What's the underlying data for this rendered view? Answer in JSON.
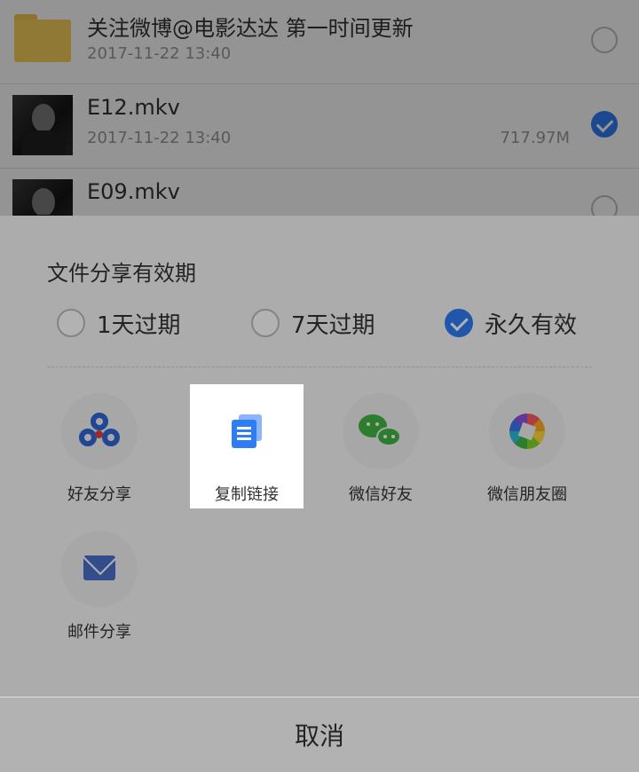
{
  "file_list": {
    "items": [
      {
        "name": "关注微博@电影达达 第一时间更新",
        "date": "2017-11-22 13:40",
        "size": "",
        "type_icon": "folder-icon",
        "selected": false
      },
      {
        "name": "E12.mkv",
        "date": "2017-11-22 13:40",
        "size": "717.97M",
        "type_icon": "video-thumbnail",
        "selected": true
      },
      {
        "name": "E09.mkv",
        "date": "",
        "size": "",
        "type_icon": "video-thumbnail",
        "selected": false
      }
    ]
  },
  "share_sheet": {
    "title": "文件分享有效期",
    "validity_options": [
      {
        "label": "1天过期",
        "selected": false
      },
      {
        "label": "7天过期",
        "selected": false
      },
      {
        "label": "永久有效",
        "selected": true
      }
    ],
    "share_targets": [
      {
        "label": "好友分享",
        "icon": "baidu-cloud-icon"
      },
      {
        "label": "复制链接",
        "icon": "copy-link-icon",
        "highlighted": true
      },
      {
        "label": "微信好友",
        "icon": "wechat-icon"
      },
      {
        "label": "微信朋友圈",
        "icon": "wechat-moments-icon"
      },
      {
        "label": "邮件分享",
        "icon": "mail-icon"
      }
    ],
    "cancel_label": "取消"
  },
  "colors": {
    "accent": "#2f7df6",
    "wechat_green": "#3fb442",
    "folder_yellow": "#f6d15c"
  }
}
